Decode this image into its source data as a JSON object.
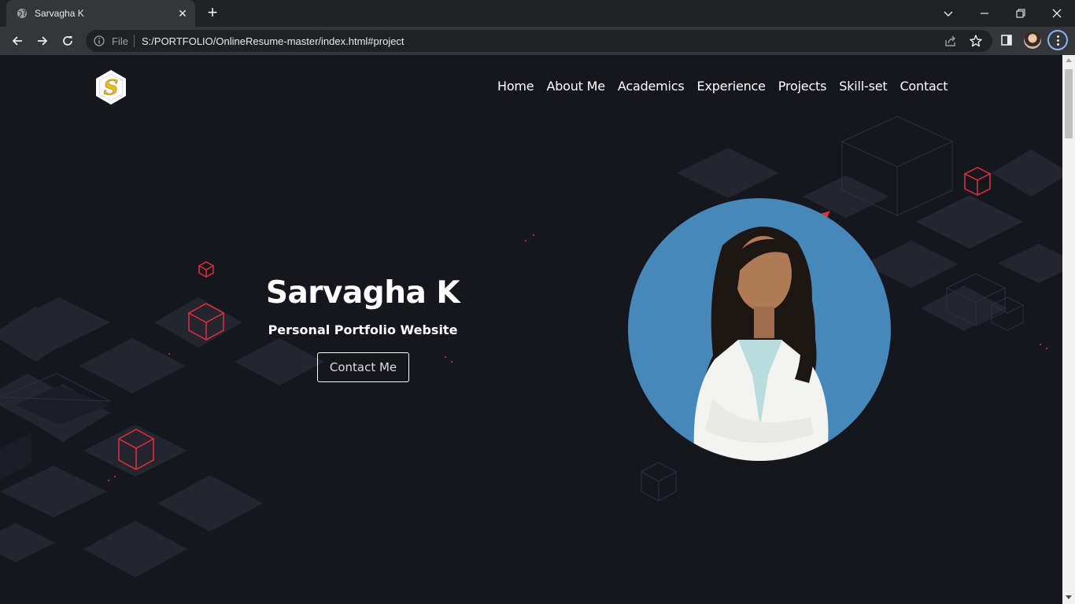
{
  "browser": {
    "tab_title": "Sarvagha K",
    "url_scheme": "File",
    "url": "S:/PORTFOLIO/OnlineResume-master/index.html#project"
  },
  "site": {
    "logo_letter": "S",
    "nav": [
      "Home",
      "About Me",
      "Academics",
      "Experience",
      "Projects",
      "Skill-set",
      "Contact"
    ],
    "hero_name": "Sarvagha K",
    "hero_subtitle": "Personal Portfolio Website",
    "cta_label": "Contact Me"
  },
  "colors": {
    "page_bg": "#16161e",
    "accent_red": "#e0303a",
    "portrait_bg": "#4788bb",
    "logo_gold": "#e8b923"
  }
}
